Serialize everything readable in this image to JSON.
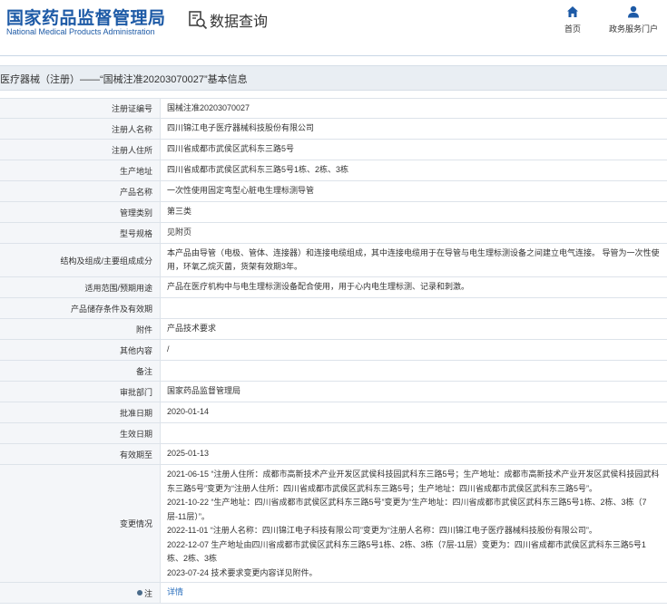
{
  "header": {
    "logo_cn": "国家药品监督管理局",
    "logo_en": "National Medical Products Administration",
    "search_label": "数据查询",
    "nav_home": "首页",
    "nav_portal": "政务服务门户"
  },
  "page_title": "医疗器械（注册）——“国械注准20203070027”基本信息",
  "rows": [
    {
      "label": "注册证编号",
      "value": "国械注准20203070027"
    },
    {
      "label": "注册人名称",
      "value": "四川锦江电子医疗器械科技股份有限公司"
    },
    {
      "label": "注册人住所",
      "value": "四川省成都市武侯区武科东三路5号"
    },
    {
      "label": "生产地址",
      "value": "四川省成都市武侯区武科东三路5号1栋、2栋、3栋"
    },
    {
      "label": "产品名称",
      "value": "一次性使用固定弯型心脏电生理标测导管"
    },
    {
      "label": "管理类别",
      "value": "第三类"
    },
    {
      "label": "型号规格",
      "value": "见附页"
    },
    {
      "label": "结构及组成/主要组成成分",
      "value": "本产品由导管（电极、管体、连接器）和连接电缆组成，其中连接电缆用于在导管与电生理标测设备之间建立电气连接。 导管为一次性使用，环氧乙烷灭菌，货架有效期3年。"
    },
    {
      "label": "适用范围/预期用途",
      "value": "产品在医疗机构中与电生理标测设备配合使用，用于心内电生理标测、记录和刺激。"
    },
    {
      "label": "产品储存条件及有效期",
      "value": ""
    },
    {
      "label": "附件",
      "value": "产品技术要求"
    },
    {
      "label": "其他内容",
      "value": "/"
    },
    {
      "label": "备注",
      "value": ""
    },
    {
      "label": "审批部门",
      "value": "国家药品监督管理局"
    },
    {
      "label": "批准日期",
      "value": "2020-01-14"
    },
    {
      "label": "生效日期",
      "value": ""
    },
    {
      "label": "有效期至",
      "value": "2025-01-13"
    }
  ],
  "changes": {
    "label": "变更情况",
    "lines": [
      "2021-06-15 “注册人住所：成都市高新技术产业开发区武侯科技园武科东三路5号；生产地址：成都市高新技术产业开发区武侯科技园武科东三路5号”变更为“注册人住所：四川省成都市武侯区武科东三路5号；生产地址：四川省成都市武侯区武科东三路5号”。",
      "2021-10-22 “生产地址：四川省成都市武侯区武科东三路5号”变更为“生产地址：四川省成都市武侯区武科东三路5号1栋、2栋、3栋（7层-11层）”。",
      "2022-11-01 “注册人名称：四川锦江电子科技有限公司”变更为“注册人名称：四川锦江电子医疗器械科技股份有限公司”。",
      "2022-12-07 生产地址由四川省成都市武侯区武科东三路5号1栋、2栋、3栋（7层-11层）变更为：四川省成都市武侯区武科东三路5号1栋、2栋、3栋",
      "2023-07-24 技术要求变更内容详见附件。"
    ]
  },
  "note": {
    "label": "注",
    "link": "详情"
  }
}
